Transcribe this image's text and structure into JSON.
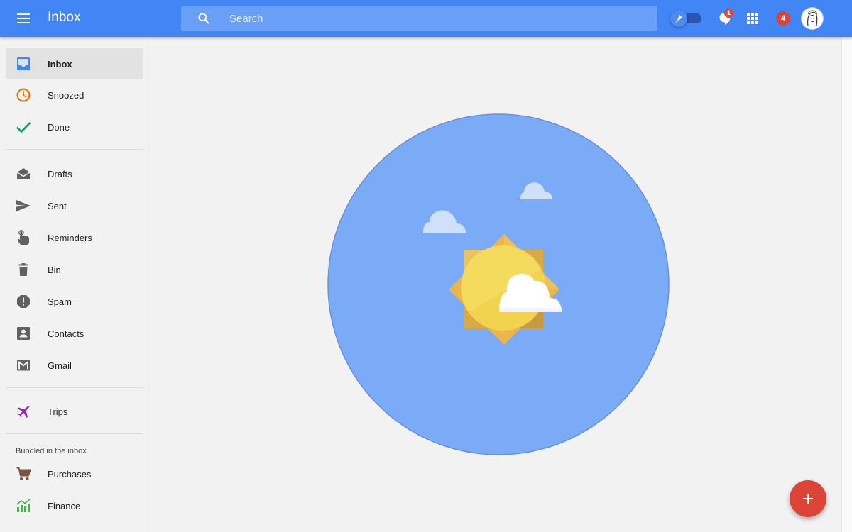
{
  "header": {
    "title": "Inbox",
    "search_placeholder": "Search",
    "chat_badge": "1",
    "notifications_count": "4"
  },
  "sidebar": {
    "items": [
      {
        "label": "Inbox",
        "icon": "inbox-icon",
        "active": true
      },
      {
        "label": "Snoozed",
        "icon": "clock-icon"
      },
      {
        "label": "Done",
        "icon": "check-icon"
      },
      {
        "label": "Drafts",
        "icon": "drafts-icon"
      },
      {
        "label": "Sent",
        "icon": "send-icon"
      },
      {
        "label": "Reminders",
        "icon": "reminder-hand-icon"
      },
      {
        "label": "Bin",
        "icon": "trash-icon"
      },
      {
        "label": "Spam",
        "icon": "spam-icon"
      },
      {
        "label": "Contacts",
        "icon": "contact-card-icon"
      },
      {
        "label": "Gmail",
        "icon": "gmail-icon"
      },
      {
        "label": "Trips",
        "icon": "airplane-icon"
      }
    ],
    "bundled_heading": "Bundled in the inbox",
    "bundles": [
      {
        "label": "Purchases",
        "icon": "shopping-cart-icon"
      },
      {
        "label": "Finance",
        "icon": "finance-chart-icon"
      }
    ]
  },
  "colors": {
    "brand_blue": "#4285f4",
    "accent_red": "#db4437",
    "snoozed_orange": "#ef6c00",
    "done_green": "#0f9d58",
    "trips_purple": "#9c27b0",
    "purchases_brown": "#795548",
    "finance_green": "#4caf50",
    "sky_blue": "#7baaf7"
  },
  "compose_icon": "plus-icon"
}
